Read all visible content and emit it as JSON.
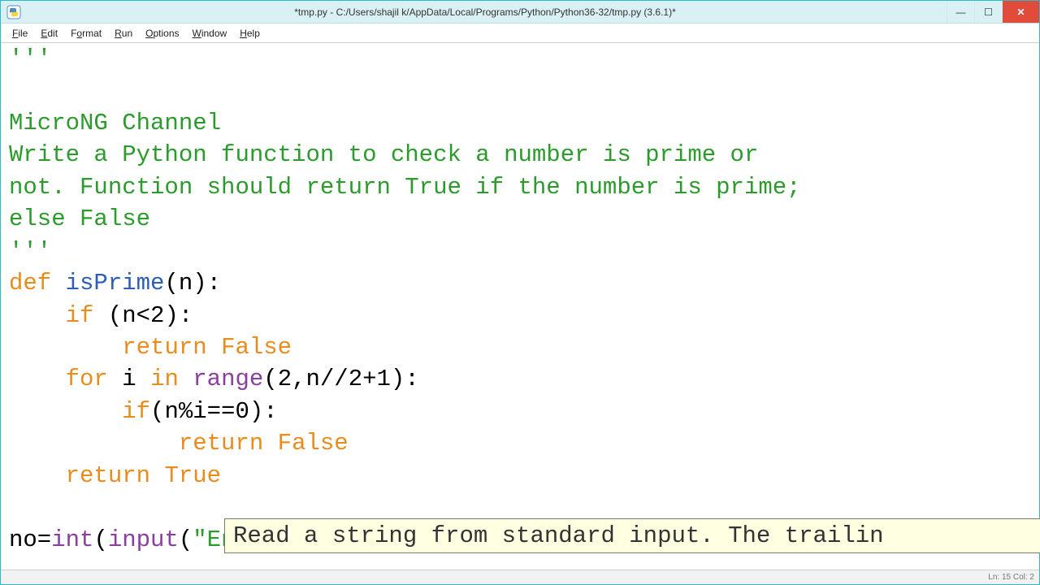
{
  "window": {
    "title": "*tmp.py - C:/Users/shajil k/AppData/Local/Programs/Python/Python36-32/tmp.py (3.6.1)*"
  },
  "menu": {
    "file": "File",
    "edit": "Edit",
    "format": "Format",
    "run": "Run",
    "options": "Options",
    "window": "Window",
    "help": "Help"
  },
  "code": {
    "tq1": "'''",
    "c1": "MicroNG Channel",
    "c2": "Write a Python function to check a number is prime or",
    "c3": "not. Function should return True if the number is prime;",
    "c4": "else False",
    "tq2": "'''",
    "def": "def",
    "fname": "isPrime",
    "lparen1": "(n):",
    "if1": "if",
    "cond1": " (n<2):",
    "ret1": "return",
    "false1": "False",
    "for": "for",
    "in": "in",
    "range": "range",
    "forrest": "(2,n//2+1):",
    "iter": " i ",
    "if2": "if",
    "cond2": "(n%i==0):",
    "ret2": "return",
    "false2": "False",
    "ret3": "return",
    "true3": "True",
    "no": "no=",
    "int": "int",
    "l2": "(",
    "input": "input",
    "l3": "(",
    "str": "\"Enter NO: \"",
    "r3": ")"
  },
  "tooltip": {
    "text": "Read a string from standard input.  The trailin"
  },
  "status": {
    "text": "Ln: 15  Col: 2"
  }
}
